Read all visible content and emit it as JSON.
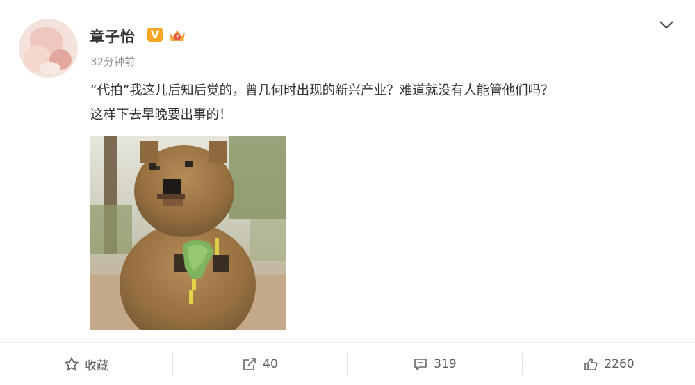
{
  "post": {
    "author": "章子怡",
    "time": "32分钟前",
    "text_line1": "“代拍”我这儿后知后觉的，曾几何时出现的新兴产业？难道就没有人能管他们吗？",
    "text_line2": "这样下去早晚要出事的！",
    "verified_badge": "V",
    "image_subject": "quokka holding a green leaf (pixelated)"
  },
  "actions": {
    "favorite_label": "收藏",
    "repost_count": "40",
    "comment_count": "319",
    "like_count": "2260"
  },
  "icons": [
    "avatar",
    "verified-v-icon",
    "member-crown-icon",
    "chevron-down-icon",
    "star-icon",
    "share-icon",
    "comment-icon",
    "thumbs-up-icon"
  ],
  "colors": {
    "accent_orange": "#f5a623",
    "text": "#333333",
    "muted": "#939393"
  }
}
